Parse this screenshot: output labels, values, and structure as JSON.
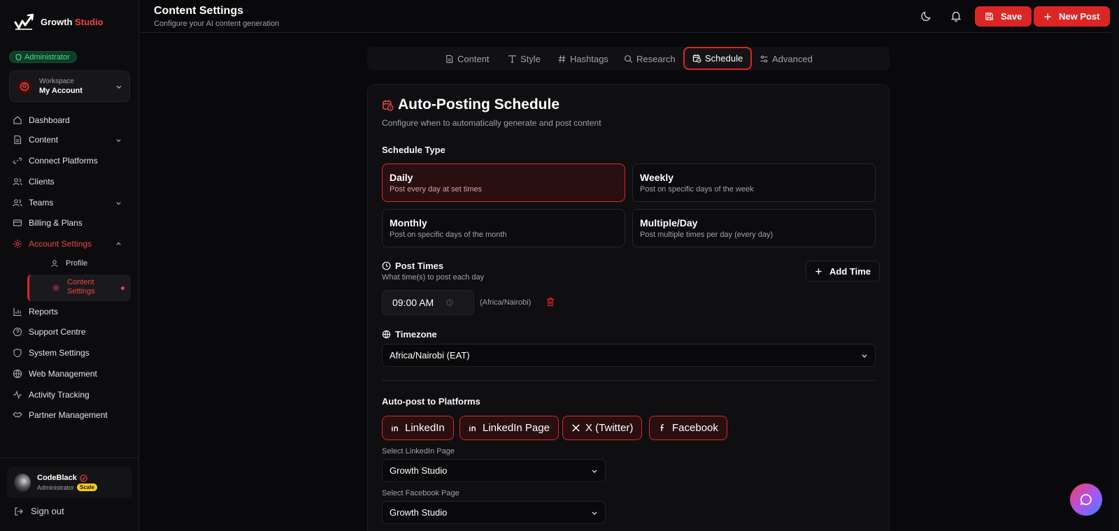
{
  "brand": {
    "name_part1": "Growth",
    "name_part2": "Studio"
  },
  "sidebar": {
    "role_badge": "Administrator",
    "workspace": {
      "label": "Workspace",
      "name": "My Account"
    },
    "items": [
      {
        "label": "Dashboard"
      },
      {
        "label": "Content"
      },
      {
        "label": "Connect Platforms"
      },
      {
        "label": "Clients"
      },
      {
        "label": "Teams"
      },
      {
        "label": "Billing & Plans"
      },
      {
        "label": "Account Settings"
      },
      {
        "label": "Reports"
      },
      {
        "label": "Support Centre"
      },
      {
        "label": "System Settings"
      },
      {
        "label": "Web Management"
      },
      {
        "label": "Activity Tracking"
      },
      {
        "label": "Partner Management"
      }
    ],
    "sub_items": [
      {
        "label": "Profile"
      },
      {
        "label": "Content Settings"
      }
    ],
    "user": {
      "name": "CodeBlack",
      "role": "Administrator",
      "plan": "Scale"
    },
    "signout": "Sign out"
  },
  "header": {
    "title": "Content Settings",
    "subtitle": "Configure your AI content generation",
    "save_label": "Save",
    "new_post_label": "New Post"
  },
  "tabs": [
    {
      "label": "Content"
    },
    {
      "label": "Style"
    },
    {
      "label": "Hashtags"
    },
    {
      "label": "Research"
    },
    {
      "label": "Schedule"
    },
    {
      "label": "Advanced"
    }
  ],
  "schedule": {
    "title": "Auto-Posting Schedule",
    "subtitle": "Configure when to automatically generate and post content",
    "type_label": "Schedule Type",
    "options": [
      {
        "title": "Daily",
        "desc": "Post every day at set times"
      },
      {
        "title": "Weekly",
        "desc": "Post on specific days of the week"
      },
      {
        "title": "Monthly",
        "desc": "Post on specific days of the month"
      },
      {
        "title": "Multiple/Day",
        "desc": "Post multiple times per day (every day)"
      }
    ],
    "post_times": {
      "label": "Post Times",
      "sub": "What time(s) to post each day",
      "add_label": "Add Time",
      "time": "09:00 AM",
      "timezone_note": "(Africa/Nairobi)"
    },
    "timezone": {
      "label": "Timezone",
      "value": "Africa/Nairobi (EAT)"
    },
    "autopost": {
      "label": "Auto-post to Platforms",
      "platforms": [
        {
          "label": "LinkedIn"
        },
        {
          "label": "LinkedIn Page"
        },
        {
          "label": "X (Twitter)"
        },
        {
          "label": "Facebook"
        }
      ],
      "linkedin_page_label": "Select LinkedIn Page",
      "linkedin_page_value": "Growth Studio",
      "facebook_page_label": "Select Facebook Page",
      "facebook_page_value": "Growth Studio"
    }
  },
  "colors": {
    "accent": "#dc2626",
    "bg": "#09090b",
    "card": "#0f0f12",
    "success": "#4ade80"
  }
}
